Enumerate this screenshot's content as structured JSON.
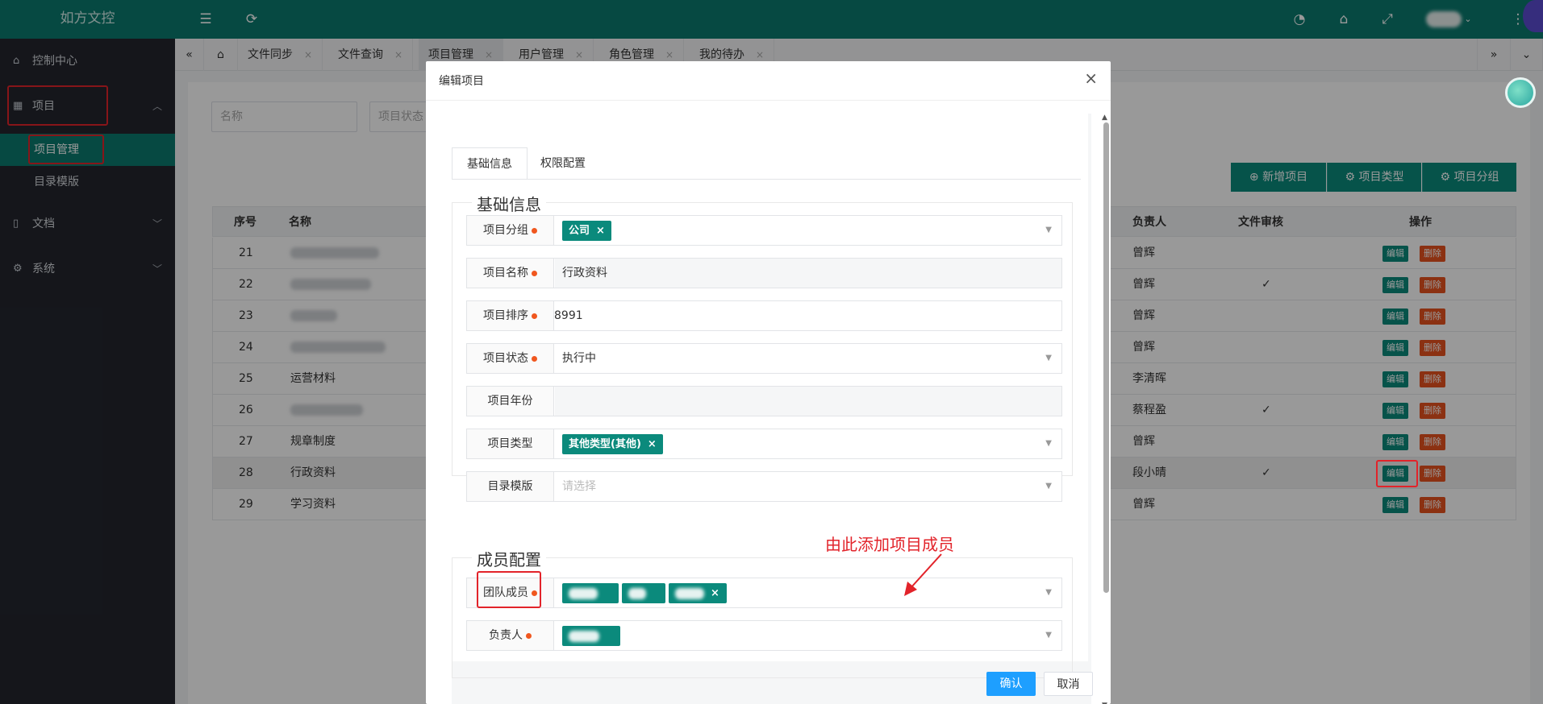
{
  "app": {
    "title": "如方文控"
  },
  "sidebar": {
    "items": [
      {
        "label": "控制中心"
      },
      {
        "label": "项目"
      },
      {
        "label": "文档"
      },
      {
        "label": "系统"
      }
    ],
    "sub_items": [
      {
        "label": "项目管理"
      },
      {
        "label": "目录模版"
      }
    ]
  },
  "tabs": [
    {
      "label": "文件同步"
    },
    {
      "label": "文件查询"
    },
    {
      "label": "项目管理"
    },
    {
      "label": "用户管理"
    },
    {
      "label": "角色管理"
    },
    {
      "label": "我的待办"
    }
  ],
  "filters": {
    "name_placeholder": "名称",
    "status_placeholder": "项目状态"
  },
  "toolbar": {
    "add": "新增项目",
    "type": "项目类型",
    "group": "项目分组"
  },
  "table": {
    "headers": {
      "index": "序号",
      "name": "名称",
      "owner": "负责人",
      "review": "文件审核",
      "ops": "操作"
    },
    "edit_label": "编辑",
    "delete_label": "删除",
    "rows": [
      {
        "index": "21",
        "name": "",
        "owner": "曾辉",
        "review": false
      },
      {
        "index": "22",
        "name": "",
        "owner": "曾辉",
        "review": true
      },
      {
        "index": "23",
        "name": "",
        "owner": "曾辉",
        "review": false
      },
      {
        "index": "24",
        "name": "",
        "owner": "曾辉",
        "review": false
      },
      {
        "index": "25",
        "name": "运营材料",
        "owner": "李清晖",
        "review": false
      },
      {
        "index": "26",
        "name": "",
        "owner": "蔡程盈",
        "review": true
      },
      {
        "index": "27",
        "name": "规章制度",
        "owner": "曾辉",
        "review": false
      },
      {
        "index": "28",
        "name": "行政资料",
        "owner": "段小晴",
        "review": true
      },
      {
        "index": "29",
        "name": "学习资料",
        "owner": "曾辉",
        "review": false
      }
    ]
  },
  "modal": {
    "title": "编辑项目",
    "tabs": {
      "basic": "基础信息",
      "perm": "权限配置"
    },
    "basic_legend": "基础信息",
    "fields": {
      "group": {
        "label": "项目分组",
        "chip": "公司"
      },
      "name": {
        "label": "项目名称",
        "value": "行政资料"
      },
      "order": {
        "label": "项目排序",
        "value": "8991"
      },
      "status": {
        "label": "项目状态",
        "value": "执行中"
      },
      "year": {
        "label": "项目年份",
        "value": ""
      },
      "type": {
        "label": "项目类型",
        "chip": "其他类型(其他)"
      },
      "template": {
        "label": "目录模版",
        "placeholder": "请选择"
      }
    },
    "member_legend": "成员配置",
    "members": {
      "label": "团队成员"
    },
    "owner": {
      "label": "负责人"
    },
    "confirm": "确认",
    "cancel": "取消"
  },
  "annotation": "由此添加项目成员",
  "colors": {
    "brand": "#0b7a6f",
    "highlight": "#e2232a",
    "primary_button": "#1e9fff",
    "danger": "#e8531f"
  }
}
